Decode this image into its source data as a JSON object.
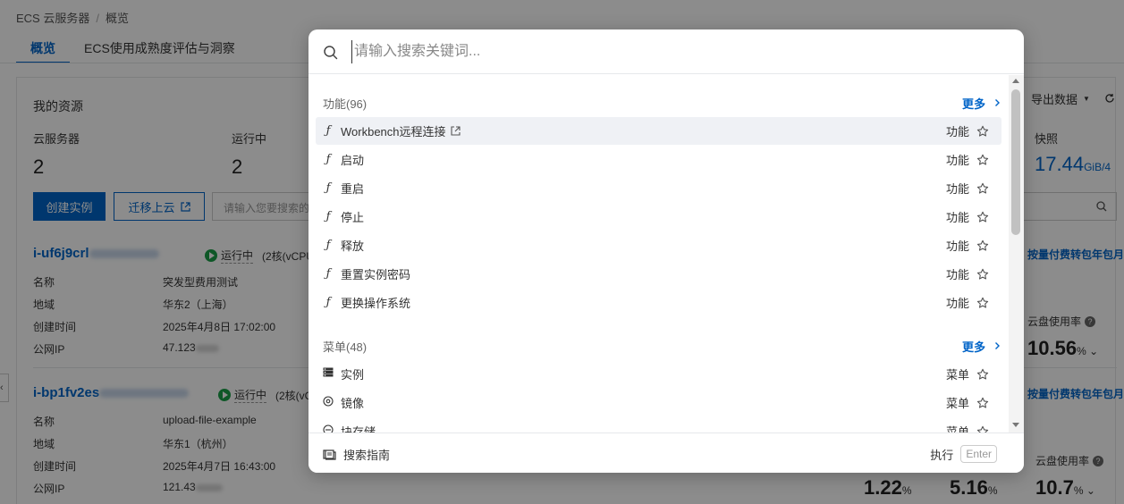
{
  "breadcrumb": {
    "root": "ECS 云服务器",
    "separator": "/",
    "current": "概览"
  },
  "tabs": [
    {
      "label": "概览"
    },
    {
      "label": "ECS使用成熟度评估与洞察"
    }
  ],
  "resources": {
    "title": "我的资源",
    "stats": [
      {
        "label": "云服务器",
        "value": "2"
      },
      {
        "label": "运行中",
        "value": "2"
      }
    ],
    "create_button": "创建实例",
    "migrate_button": "迁移上云",
    "search_placeholder": "请输入您要搜索的",
    "export_label": "导出数据",
    "snapshot_label": "快照",
    "snapshot_value": "17.44",
    "snapshot_unit": "GiB/4",
    "instances": [
      {
        "id": "i-uf6j9crl",
        "status": "运行中",
        "spec": "(2核(vCPU",
        "fields": [
          {
            "k": "名称",
            "v": "突发型费用测试"
          },
          {
            "k": "地域",
            "v": "华东2（上海）"
          },
          {
            "k": "创建时间",
            "v": "2025年4月8日 17:02:00"
          },
          {
            "k": "公网IP",
            "v": "47.123"
          }
        ],
        "billing_link": "按量付费转包年包月",
        "disk_label": "云盘使用率",
        "disk_value": "10.56",
        "disk_unit": "%"
      },
      {
        "id": "i-bp1fv2es",
        "status": "运行中",
        "spec": "(2核(vC",
        "fields": [
          {
            "k": "名称",
            "v": "upload-file-example"
          },
          {
            "k": "地域",
            "v": "华东1（杭州）"
          },
          {
            "k": "创建时间",
            "v": "2025年4月7日 16:43:00"
          },
          {
            "k": "公网IP",
            "v": "121.43"
          }
        ],
        "billing_link": "按量付费转包年包月",
        "disk_label": "云盘使用率",
        "disk_value": "10.7",
        "disk_unit": "%",
        "extra_values": [
          {
            "value": "1.22",
            "unit": "%"
          },
          {
            "value": "5.16",
            "unit": "%"
          }
        ]
      }
    ]
  },
  "search_modal": {
    "placeholder": "请输入搜索关键词...",
    "sections": [
      {
        "title": "功能(96)",
        "more": "更多",
        "items": [
          {
            "label": "Workbench远程连接",
            "type": "功能",
            "icon": "function-icon",
            "external": true,
            "highlighted": true
          },
          {
            "label": "启动",
            "type": "功能",
            "icon": "function-icon"
          },
          {
            "label": "重启",
            "type": "功能",
            "icon": "function-icon"
          },
          {
            "label": "停止",
            "type": "功能",
            "icon": "function-icon"
          },
          {
            "label": "释放",
            "type": "功能",
            "icon": "function-icon"
          },
          {
            "label": "重置实例密码",
            "type": "功能",
            "icon": "function-icon"
          },
          {
            "label": "更换操作系统",
            "type": "功能",
            "icon": "function-icon"
          }
        ]
      },
      {
        "title": "菜单(48)",
        "more": "更多",
        "items": [
          {
            "label": "实例",
            "type": "菜单",
            "icon": "server-icon"
          },
          {
            "label": "镜像",
            "type": "菜单",
            "icon": "image-disc-icon"
          },
          {
            "label": "块存储",
            "type": "菜单",
            "icon": "storage-icon"
          }
        ]
      }
    ],
    "footer": {
      "guide": "搜索指南",
      "execute": "执行",
      "key": "Enter"
    }
  },
  "colors": {
    "accent": "#0064c8",
    "running": "#1a9f48",
    "highlight_row": "#eff1f5"
  }
}
